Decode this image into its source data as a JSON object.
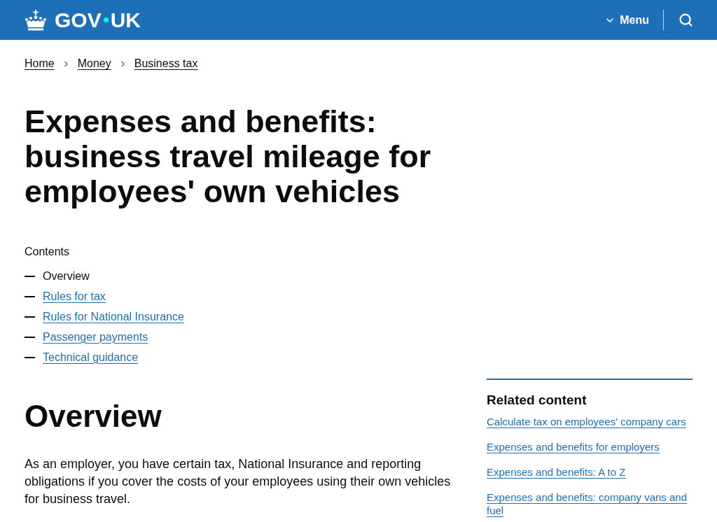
{
  "header": {
    "logo_parts": [
      "GOV",
      "UK"
    ],
    "menu_label": "Menu"
  },
  "breadcrumbs": [
    "Home",
    "Money",
    "Business tax"
  ],
  "title": "Expenses and benefits: business travel mileage for employees' own vehicles",
  "contents": {
    "heading": "Contents",
    "items": [
      {
        "label": "Overview",
        "selected": true
      },
      {
        "label": "Rules for tax",
        "selected": false
      },
      {
        "label": "Rules for National Insurance",
        "selected": false
      },
      {
        "label": "Passenger payments",
        "selected": false
      },
      {
        "label": "Technical guidance",
        "selected": false
      }
    ]
  },
  "section": {
    "heading": "Overview",
    "paragraph": "As an employer, you have certain tax, National Insurance and reporting obligations if you cover the costs of your employees using their own vehicles for business travel."
  },
  "related_content": {
    "heading": "Related content",
    "links": [
      "Calculate tax on employees' company cars",
      "Expenses and benefits for employers",
      "Expenses and benefits: A to Z",
      "Expenses and benefits: company vans and fuel"
    ]
  }
}
